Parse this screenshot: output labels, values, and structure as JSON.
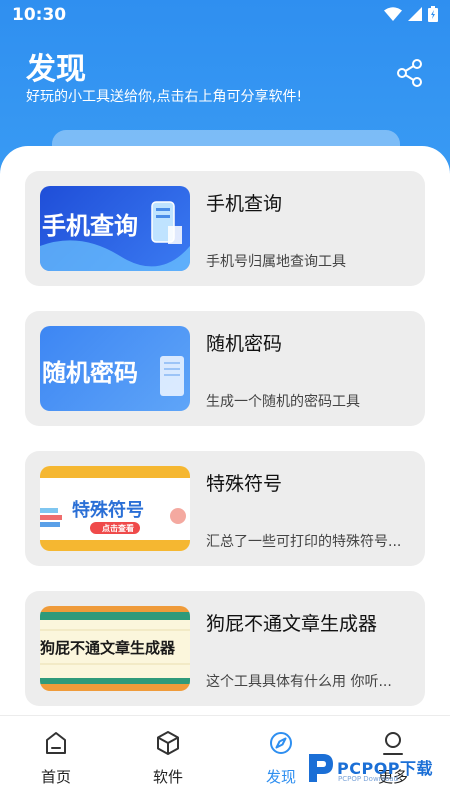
{
  "status": {
    "time": "10:30"
  },
  "header": {
    "title": "发现",
    "subtitle": "好玩的小工具送给你,点击右上角可分享软件!"
  },
  "cards": [
    {
      "title": "手机查询",
      "desc": "手机号归属地查询工具",
      "thumb_text": "手机查询"
    },
    {
      "title": "随机密码",
      "desc": "生成一个随机的密码工具",
      "thumb_text": "随机密码"
    },
    {
      "title": "特殊符号",
      "desc": "汇总了一些可打印的特殊符号...",
      "thumb_text": "特殊符号",
      "thumb_badge": "点击查看"
    },
    {
      "title": "狗屁不通文章生成器",
      "desc": "这个工具具体有什么用 你听...",
      "thumb_text": "狗屁不通文章生成器"
    }
  ],
  "nav": [
    {
      "label": "首页",
      "icon": "home-icon"
    },
    {
      "label": "软件",
      "icon": "box-icon"
    },
    {
      "label": "发现",
      "icon": "compass-icon",
      "active": true
    },
    {
      "label": "更多",
      "icon": "person-icon"
    }
  ],
  "watermark": {
    "text": "PCPOP下载",
    "sub": "PCPOP Download"
  },
  "colors": {
    "primary": "#2f8ff0",
    "card_bg": "#ededed"
  }
}
